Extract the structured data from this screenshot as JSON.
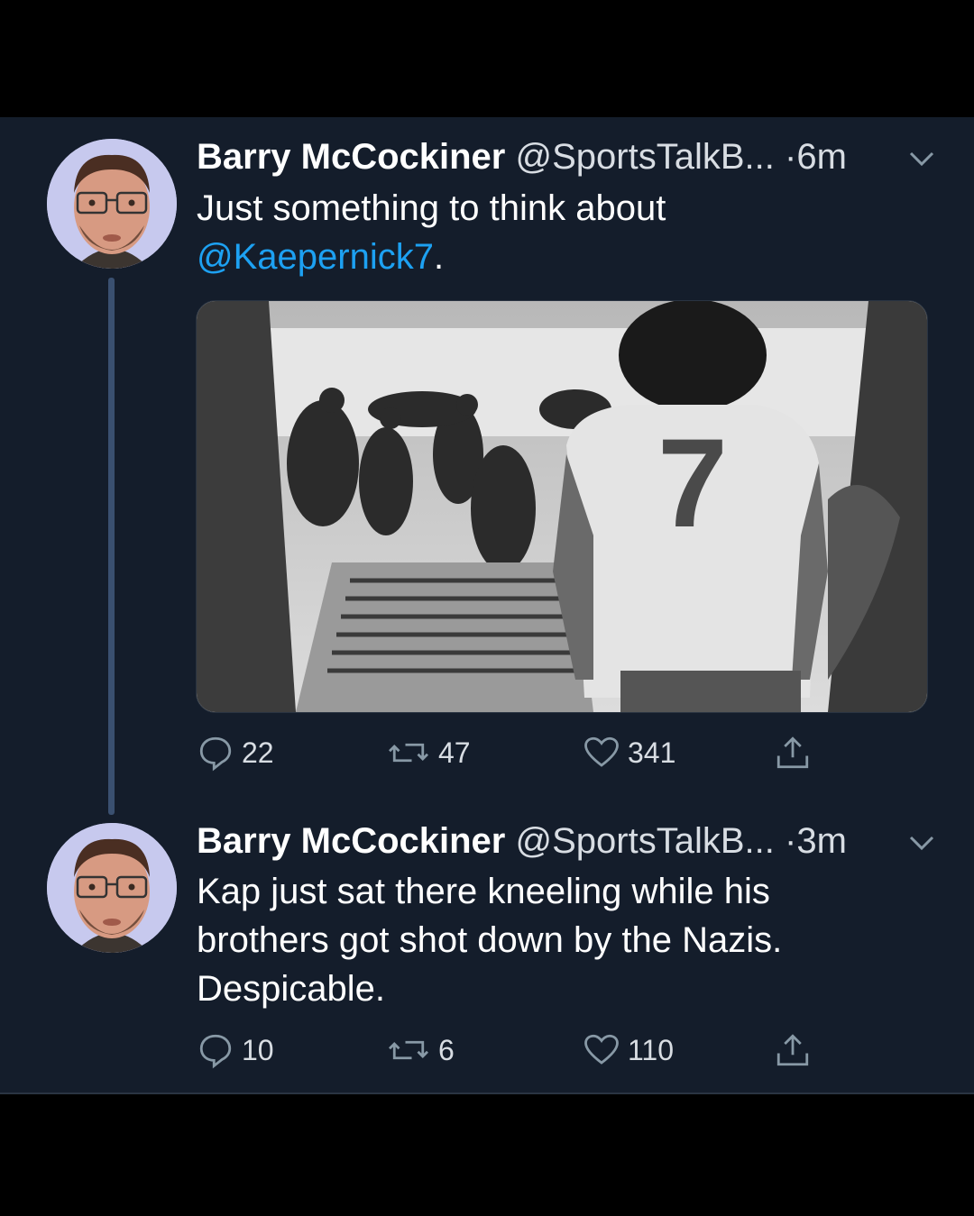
{
  "tweets": [
    {
      "name": "Barry McCockiner",
      "handle": "@SportsTalkB...",
      "dot": "·",
      "time": "6m",
      "text_prefix": "Just something to think about",
      "mention": "@Kaepernick7",
      "text_suffix": ".",
      "has_image": true,
      "image_jersey_number": "7",
      "replies": "22",
      "retweets": "47",
      "likes": "341"
    },
    {
      "name": "Barry McCockiner",
      "handle": "@SportsTalkB...",
      "dot": "·",
      "time": "3m",
      "text": "Kap just sat there kneeling while his brothers got shot down by the Nazis. Despicable.",
      "replies": "10",
      "retweets": "6",
      "likes": "110"
    }
  ],
  "icons": {
    "reply": "speech-bubble-icon",
    "retweet": "retweet-arrows-icon",
    "like": "heart-icon",
    "share": "share-upload-icon",
    "menu": "chevron-down-icon"
  },
  "colors": {
    "background": "#141d2b",
    "mention": "#1da1f2",
    "muted": "#8899a6",
    "thread_line": "#3a5070"
  }
}
